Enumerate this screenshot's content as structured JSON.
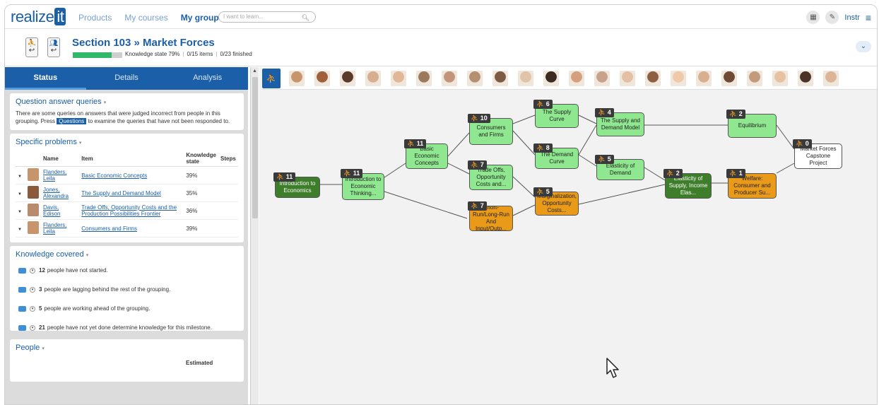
{
  "nav": {
    "logo_text": "realize",
    "logo_badge": "it",
    "links": [
      "Products",
      "My courses",
      "My groups"
    ],
    "active_link": "My groups",
    "search_placeholder": "I want to learn...",
    "user": "Instr"
  },
  "section": {
    "title": "Section 103 » Market Forces",
    "knowledge_state_label": "Knowledge state 79%",
    "knowledge_state": 0.79,
    "items": "0/15 items",
    "finished": "0/23 finished"
  },
  "tabs": [
    "Status",
    "Details",
    "Analysis"
  ],
  "question_queries": {
    "title": "Question answer queries",
    "text_before": "There are some queries on answers that were judged incorrect from people in this grouping. Press",
    "button": "Questions",
    "text_after": "to examine the queries that have not been responded to."
  },
  "specific_problems": {
    "title": "Specific problems",
    "headers": [
      "Name",
      "Item",
      "Knowledge state",
      "Steps"
    ],
    "rows": [
      {
        "name": "Flanders, Leila",
        "item": "Basic Economic Concepts",
        "ks": "39%",
        "face": "#c8946b"
      },
      {
        "name": "Jones, Alexandra",
        "item": "The Supply and Demand Model",
        "ks": "35%",
        "face": "#8a5a3c"
      },
      {
        "name": "Davis, Edison",
        "item": "Trade Offs, Opportunity Costs and the Production Possibilities Frontier",
        "ks": "36%",
        "face": "#b98a6b"
      },
      {
        "name": "Flanders, Leila",
        "item": "Consumers and Firms",
        "ks": "39%",
        "face": "#c8946b"
      }
    ]
  },
  "knowledge_covered": {
    "title": "Knowledge covered",
    "rows": [
      {
        "num": "12",
        "text": "people have not started."
      },
      {
        "num": "3",
        "text": "people are lagging behind the rest of the grouping."
      },
      {
        "num": "5",
        "text": "people are working ahead of the grouping."
      },
      {
        "num": "21",
        "text": "people have not yet done determine knowledge for this milestone."
      }
    ]
  },
  "people": {
    "title": "People",
    "header": "Estimated"
  },
  "graph": {
    "nodes": [
      {
        "id": "intro",
        "label": "Introduction to Economics",
        "badge": "11",
        "color": "dg"
      },
      {
        "id": "thinking",
        "label": "Introduction to Economic Thinking...",
        "badge": "11",
        "color": "lg"
      },
      {
        "id": "basic",
        "label": "Basic Economic Concepts",
        "badge": "11",
        "color": "lg"
      },
      {
        "id": "consumers",
        "label": "Consumers and Firms",
        "badge": "10",
        "color": "lg"
      },
      {
        "id": "tradeoffs",
        "label": "Trade Offs, Opportunity Costs and...",
        "badge": "7",
        "color": "lg"
      },
      {
        "id": "shortrun",
        "label": "Short-Run/Long-Run And Input/Outp...",
        "badge": "7",
        "color": "or"
      },
      {
        "id": "supply",
        "label": "The Supply Curve",
        "badge": "6",
        "color": "lg"
      },
      {
        "id": "demand",
        "label": "The Demand Curve",
        "badge": "8",
        "color": "lg"
      },
      {
        "id": "marginal",
        "label": "Marginalization, Opportunity Costs...",
        "badge": "5",
        "color": "or"
      },
      {
        "id": "sdmodel",
        "label": "The Supply and Demand Model",
        "badge": "4",
        "color": "lg"
      },
      {
        "id": "elasticity",
        "label": "Elasticity of Demand",
        "badge": "5",
        "color": "lg"
      },
      {
        "id": "elassupply",
        "label": "Elasticity of Supply, Income Elas...",
        "badge": "2",
        "color": "dg"
      },
      {
        "id": "equilibrium",
        "label": "Equilibrium",
        "badge": "2",
        "color": "lg"
      },
      {
        "id": "welfare",
        "label": "Welfare: Consumer and Producer Su...",
        "badge": "1",
        "color": "or"
      },
      {
        "id": "capstone",
        "label": "Market Forces Capstone Project",
        "badge": "0",
        "color": "wh"
      }
    ]
  },
  "avatar_colors": [
    "#c8946b",
    "#a0603c",
    "#5a3a2a",
    "#d7ae90",
    "#e0b898",
    "#9a7a5a",
    "#c2957a",
    "#b58f72",
    "#7c5a44",
    "#e1c4a8",
    "#3d2b22",
    "#d4a07e",
    "#c6a38a",
    "#e3bfa3",
    "#8f5f43",
    "#f0c9a9",
    "#d9b08f",
    "#6e4a36",
    "#c39a7c",
    "#e6c2a2",
    "#4a3226",
    "#dcb596"
  ]
}
